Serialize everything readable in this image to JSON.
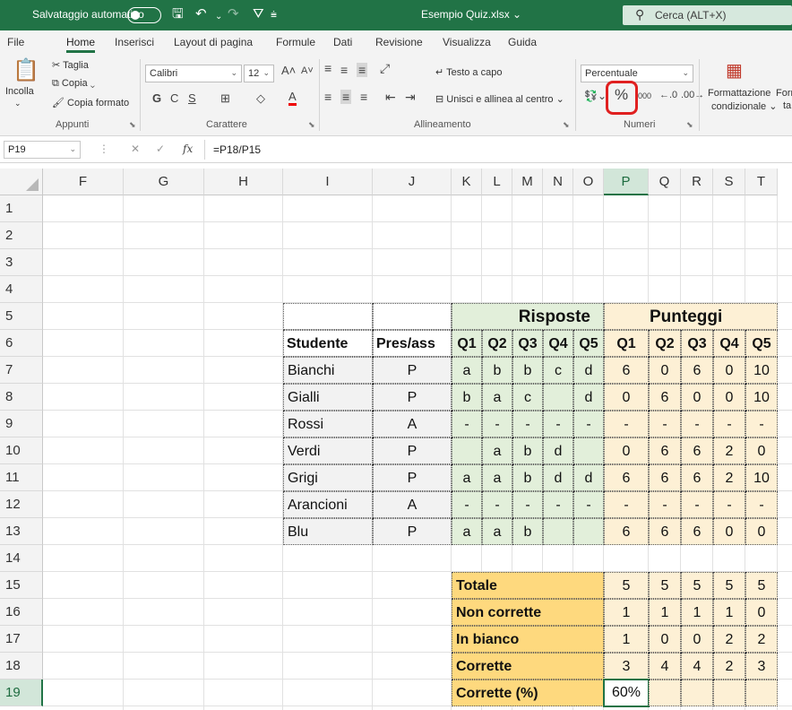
{
  "titlebar": {
    "autosave_label": "Salvataggio automatico",
    "filename": "Esempio Quiz.xlsx ⌄",
    "search_placeholder": "Cerca (ALT+X)"
  },
  "menu": [
    "File",
    "Home",
    "Inserisci",
    "Layout di pagina",
    "Formule",
    "Dati",
    "Revisione",
    "Visualizza",
    "Guida"
  ],
  "ribbon": {
    "clipboard": {
      "paste": "Incolla",
      "cut": "Taglia",
      "copy": "Copia",
      "format_painter": "Copia formato",
      "group": "Appunti"
    },
    "font": {
      "name": "Calibri",
      "size": "12",
      "bold": "G",
      "italic": "C",
      "underline": "S",
      "group": "Carattere"
    },
    "alignment": {
      "wrap": "Testo a capo",
      "merge": "Unisci e allinea al centro",
      "group": "Allineamento"
    },
    "number": {
      "format": "Percentuale",
      "percent": "%",
      "thousands": "000",
      "group": "Numeri"
    },
    "styles": {
      "conditional_1": "Formattazione",
      "conditional_2": "condizionale ⌄",
      "next_1": "Form",
      "next_2": "ta"
    }
  },
  "formula_bar": {
    "cell_ref": "P19",
    "fx": "fx",
    "formula": "=P18/P15"
  },
  "columns": [
    "F",
    "G",
    "H",
    "I",
    "J",
    "K",
    "L",
    "M",
    "N",
    "O",
    "P",
    "Q",
    "R",
    "S",
    "T"
  ],
  "selected_column": "P",
  "rows": [
    "1",
    "2",
    "3",
    "4",
    "5",
    "6",
    "7",
    "8",
    "9",
    "10",
    "11",
    "12",
    "13",
    "14",
    "15",
    "16",
    "17",
    "18",
    "19"
  ],
  "selected_row": "19",
  "table": {
    "risposte_header": "Risposte",
    "punteggi_header": "Punteggi",
    "headers": [
      "Studente",
      "Pres/ass",
      "Q1",
      "Q2",
      "Q3",
      "Q4",
      "Q5",
      "Q1",
      "Q2",
      "Q3",
      "Q4",
      "Q5"
    ],
    "students": [
      {
        "name": "Bianchi",
        "pres": "P",
        "answers": [
          "a",
          "b",
          "b",
          "c",
          "d"
        ],
        "scores": [
          "6",
          "0",
          "6",
          "0",
          "10"
        ]
      },
      {
        "name": "Gialli",
        "pres": "P",
        "answers": [
          "b",
          "a",
          "c",
          "",
          "d"
        ],
        "scores": [
          "0",
          "6",
          "0",
          "0",
          "10"
        ]
      },
      {
        "name": "Rossi",
        "pres": "A",
        "answers": [
          "-",
          "-",
          "-",
          "-",
          "-"
        ],
        "scores": [
          "-",
          "-",
          "-",
          "-",
          "-"
        ]
      },
      {
        "name": "Verdi",
        "pres": "P",
        "answers": [
          "",
          "a",
          "b",
          "d",
          ""
        ],
        "scores": [
          "0",
          "6",
          "6",
          "2",
          "0"
        ]
      },
      {
        "name": "Grigi",
        "pres": "P",
        "answers": [
          "a",
          "a",
          "b",
          "d",
          "d"
        ],
        "scores": [
          "6",
          "6",
          "6",
          "2",
          "10"
        ]
      },
      {
        "name": "Arancioni",
        "pres": "A",
        "answers": [
          "-",
          "-",
          "-",
          "-",
          "-"
        ],
        "scores": [
          "-",
          "-",
          "-",
          "-",
          "-"
        ]
      },
      {
        "name": "Blu",
        "pres": "P",
        "answers": [
          "a",
          "a",
          "b",
          "",
          ""
        ],
        "scores": [
          "6",
          "6",
          "6",
          "0",
          "0"
        ]
      }
    ],
    "summary": [
      {
        "label": "Totale",
        "values": [
          "5",
          "5",
          "5",
          "5",
          "5"
        ]
      },
      {
        "label": "Non corrette",
        "values": [
          "1",
          "1",
          "1",
          "1",
          "0"
        ]
      },
      {
        "label": "In bianco",
        "values": [
          "1",
          "0",
          "0",
          "2",
          "2"
        ]
      },
      {
        "label": "Corrette",
        "values": [
          "3",
          "4",
          "4",
          "2",
          "3"
        ]
      },
      {
        "label": "Corrette (%)",
        "values": [
          "60%",
          "",
          "",
          "",
          ""
        ]
      }
    ]
  }
}
